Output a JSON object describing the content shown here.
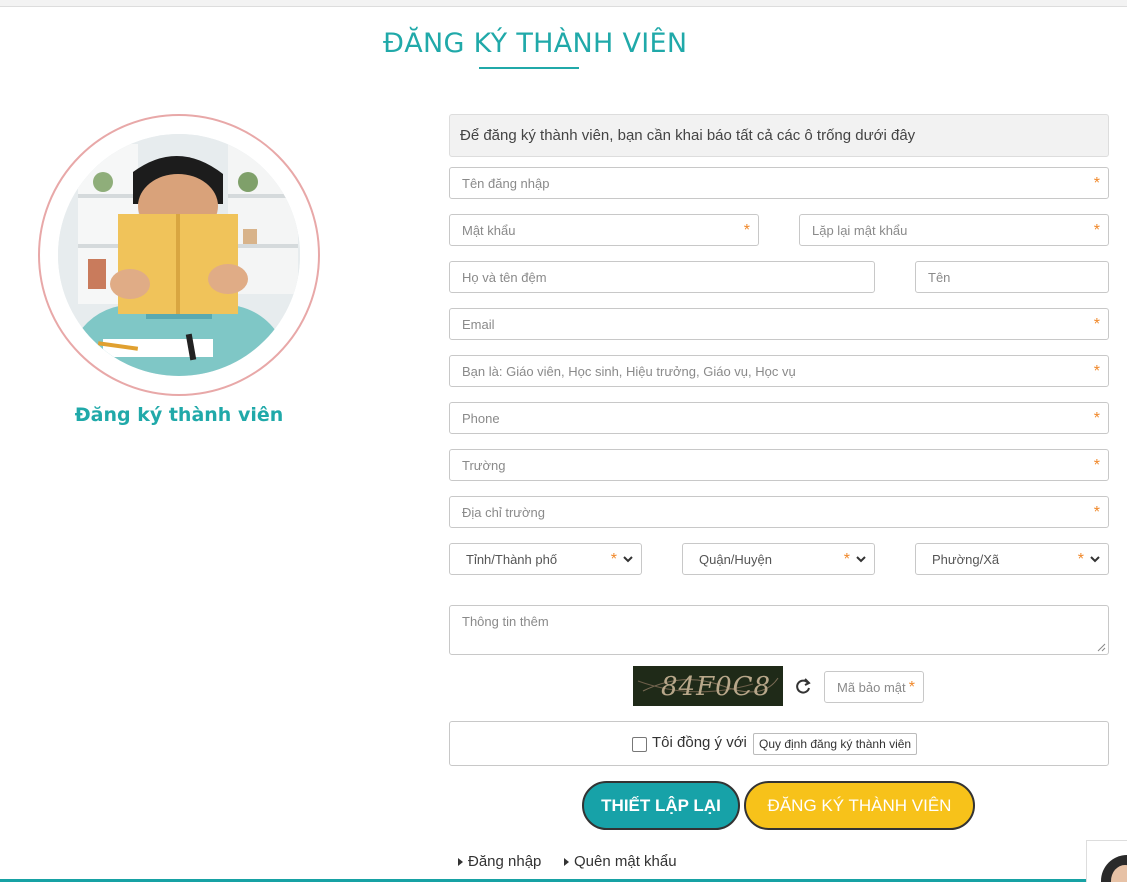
{
  "page": {
    "title": "ĐĂNG KÝ THÀNH VIÊN",
    "avatar_caption": "Đăng ký thành viên",
    "notice": "Để đăng ký thành viên, bạn cần khai báo tất cả các ô trống dưới đây"
  },
  "form": {
    "required_mark": "*",
    "username": {
      "placeholder": "Tên đăng nhập"
    },
    "password": {
      "placeholder": "Mật khẩu"
    },
    "password_confirm": {
      "placeholder": "Lặp lại mật khẩu"
    },
    "last_name": {
      "placeholder": "Họ và tên đệm"
    },
    "first_name": {
      "placeholder": "Tên"
    },
    "email": {
      "placeholder": "Email"
    },
    "role": {
      "placeholder": "Bạn là: Giáo viên, Học sinh, Hiệu trưởng, Giáo vụ, Học vụ"
    },
    "phone": {
      "placeholder": "Phone"
    },
    "school": {
      "placeholder": "Trường"
    },
    "school_address": {
      "placeholder": "Địa chỉ trường"
    },
    "province": {
      "selected": "Tỉnh/Thành phố"
    },
    "district": {
      "selected": "Quận/Huyện"
    },
    "ward": {
      "selected": "Phường/Xã"
    },
    "extra_info": {
      "placeholder": "Thông tin thêm"
    },
    "captcha": {
      "image_text": "84F0C8",
      "placeholder": "Mã bảo mật"
    },
    "agree": {
      "label": "Tôi đồng ý với",
      "link": "Quy định đăng ký thành viên"
    }
  },
  "buttons": {
    "reset": "THIẾT LẬP LẠI",
    "submit": "ĐĂNG KÝ THÀNH VIÊN"
  },
  "footer_links": {
    "login": "Đăng nhập",
    "forgot": "Quên mật khẩu"
  },
  "colors": {
    "teal": "#20a9a9",
    "orange_required": "#f0882a",
    "yellow_button": "#f7c21a",
    "teal_button": "#17a2a8"
  }
}
